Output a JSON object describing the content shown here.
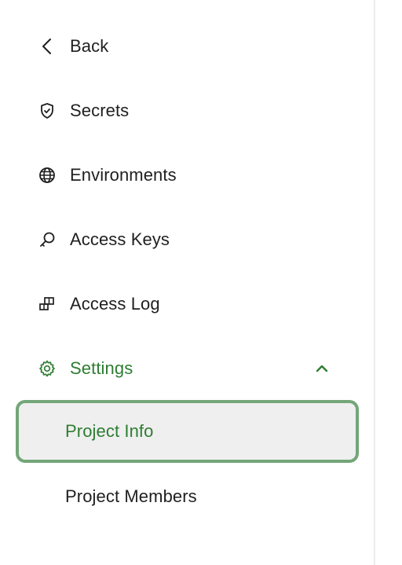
{
  "nav": {
    "back_label": "Back",
    "items": [
      {
        "label": "Secrets",
        "icon": "shield-icon"
      },
      {
        "label": "Environments",
        "icon": "globe-icon"
      },
      {
        "label": "Access Keys",
        "icon": "key-icon"
      },
      {
        "label": "Access Log",
        "icon": "log-icon"
      }
    ],
    "settings": {
      "label": "Settings",
      "icon": "gear-icon",
      "expanded": true,
      "children": [
        {
          "label": "Project Info",
          "active": true
        },
        {
          "label": "Project Members",
          "active": false
        }
      ]
    }
  },
  "colors": {
    "accent": "#2e7d32",
    "active_border": "#73a678",
    "active_bg": "#efefef",
    "text": "#1f1f1f"
  }
}
